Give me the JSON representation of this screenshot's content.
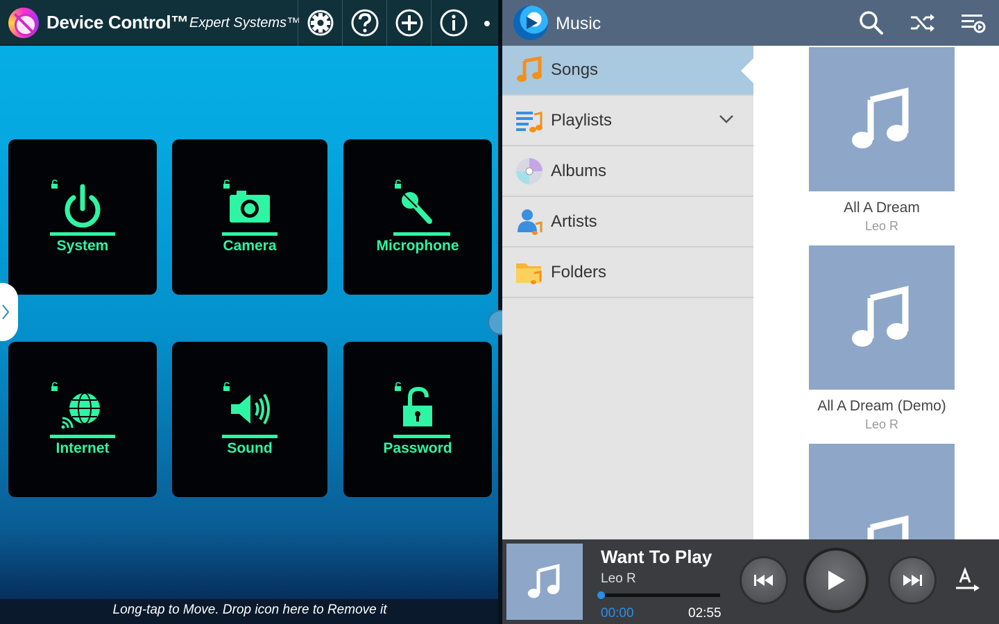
{
  "device_control": {
    "title": "Device Control™",
    "subtitle": "Expert Systems™",
    "toolbar": [
      "settings-icon",
      "help-icon",
      "add-icon",
      "info-icon"
    ],
    "tiles": [
      {
        "label": "System",
        "icon": "power-icon"
      },
      {
        "label": "Camera",
        "icon": "camera-icon"
      },
      {
        "label": "Microphone",
        "icon": "microphone-icon"
      },
      {
        "label": "Internet",
        "icon": "globe-icon"
      },
      {
        "label": "Sound",
        "icon": "speaker-icon"
      },
      {
        "label": "Password",
        "icon": "padlock-open-icon"
      }
    ],
    "footer": "Long-tap to Move. Drop icon here to Remove it",
    "accent_color": "#2ef5a4"
  },
  "music": {
    "title": "Music",
    "toolbar": [
      "search-icon",
      "shuffle-icon",
      "queue-icon"
    ],
    "nav": [
      {
        "label": "Songs",
        "active": true,
        "icon": "music-note-icon"
      },
      {
        "label": "Playlists",
        "active": false,
        "icon": "playlist-icon",
        "expandable": true
      },
      {
        "label": "Albums",
        "active": false,
        "icon": "disc-icon"
      },
      {
        "label": "Artists",
        "active": false,
        "icon": "artist-icon"
      },
      {
        "label": "Folders",
        "active": false,
        "icon": "folder-icon"
      }
    ],
    "songs": [
      {
        "title": "All A Dream",
        "artist": "Leo R"
      },
      {
        "title": "All A Dream (Demo)",
        "artist": "Leo R"
      },
      {
        "title": "",
        "artist": ""
      }
    ],
    "player": {
      "title": "Want To Play",
      "artist": "Leo R",
      "current_time": "00:00",
      "total_time": "02:55",
      "progress": 0
    },
    "colors": {
      "header": "#52677f",
      "active_nav": "#a8c9e0",
      "art": "#8ea7c8",
      "progress": "#2a8fe6"
    }
  }
}
